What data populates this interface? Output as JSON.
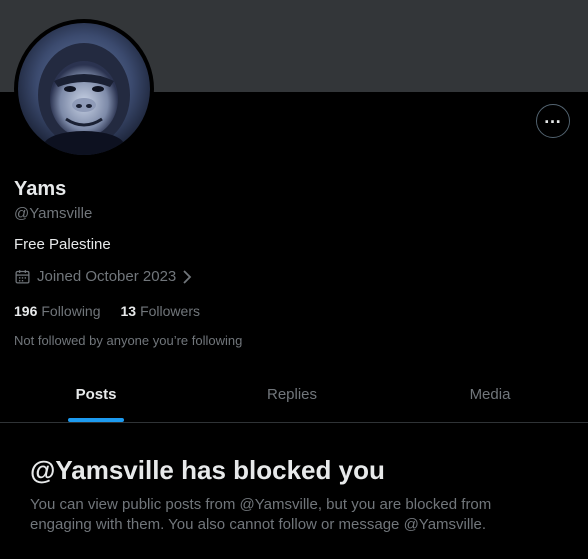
{
  "profile": {
    "display_name": "Yams",
    "handle": "@Yamsville",
    "bio": "Free Palestine",
    "joined": "Joined October 2023",
    "following_count": "196",
    "following_label": "Following",
    "followers_count": "13",
    "followers_label": "Followers",
    "not_followed_text": "Not followed by anyone you’re following",
    "more_icon": "ellipsis-icon",
    "calendar_icon": "calendar-icon"
  },
  "tabs": [
    {
      "label": "Posts",
      "active": true
    },
    {
      "label": "Replies",
      "active": false
    },
    {
      "label": "Media",
      "active": false
    }
  ],
  "blocked": {
    "title": "@Yamsville has blocked you",
    "description": "You can view public posts from @Yamsville, but you are blocked from engaging with them. You also cannot follow or message @Yamsville."
  },
  "colors": {
    "background": "#000000",
    "banner": "#333639",
    "accent": "#1d9bf0",
    "secondary_text": "#71767b",
    "primary_text": "#e7e9ea"
  }
}
